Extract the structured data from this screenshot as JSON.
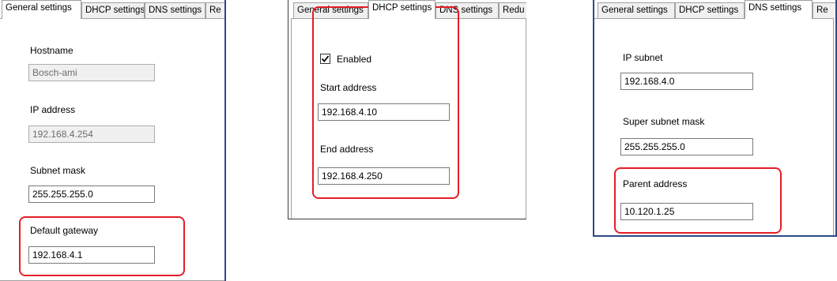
{
  "general": {
    "tabs": [
      "General settings",
      "DHCP settings",
      "DNS settings",
      "Re"
    ],
    "hostname_label": "Hostname",
    "hostname_value": "Bosch-ami",
    "ip_label": "IP address",
    "ip_value": "192.168.4.254",
    "subnet_label": "Subnet mask",
    "subnet_value": "255.255.255.0",
    "gateway_label": "Default gateway",
    "gateway_value": "192.168.4.1"
  },
  "dhcp": {
    "tabs": [
      "General settings",
      "DHCP settings",
      "DNS settings",
      "Redu"
    ],
    "enabled_label": "Enabled",
    "enabled_checked": true,
    "start_label": "Start address",
    "start_value": "192.168.4.10",
    "end_label": "End address",
    "end_value": "192.168.4.250"
  },
  "dns": {
    "tabs": [
      "General settings",
      "DHCP settings",
      "DNS settings",
      "Re"
    ],
    "ip_subnet_label": "IP subnet",
    "ip_subnet_value": "192.168.4.0",
    "super_mask_label": "Super subnet mask",
    "super_mask_value": "255.255.255.0",
    "parent_label": "Parent address",
    "parent_value": "10.120.1.25"
  },
  "colors": {
    "highlight": "#e41e26",
    "frame": "#2b4a8a"
  }
}
